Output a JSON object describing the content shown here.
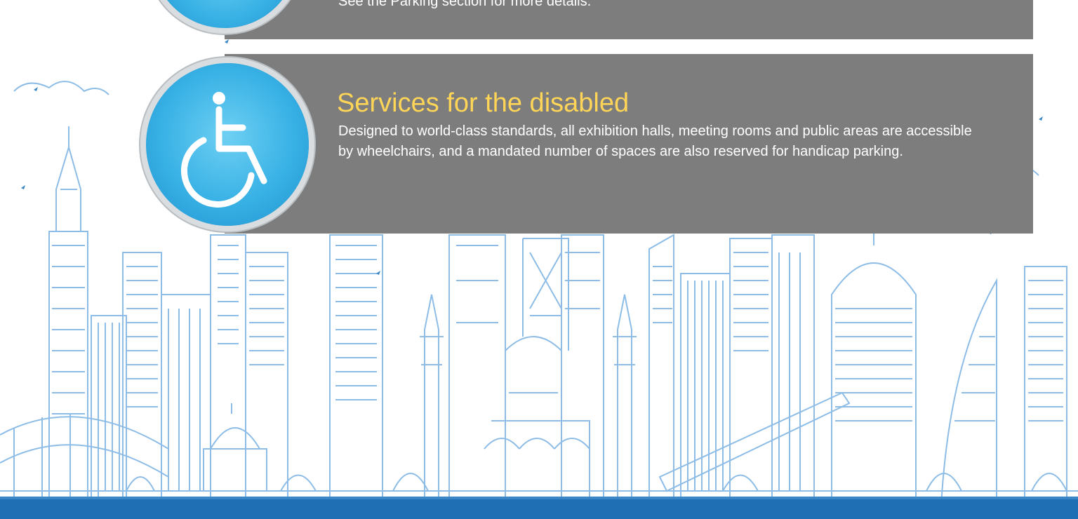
{
  "colors": {
    "panel_background": "#7d7d7d",
    "title_color": "#ffd557",
    "text_color": "#ffffff",
    "badge_blue": "#38b1e5",
    "footer_blue": "#1f6fb5",
    "skyline_stroke": "#7fb4e2"
  },
  "sections": [
    {
      "icon": "car-icon",
      "text": "See the Parking section for more details."
    },
    {
      "icon": "wheelchair-icon",
      "title": "Services for the disabled",
      "text": "Designed to world-class standards, all exhibition halls, meeting rooms and public areas are accessible by wheelchairs, and a mandated number of spaces are also reserved for handicap parking."
    }
  ]
}
